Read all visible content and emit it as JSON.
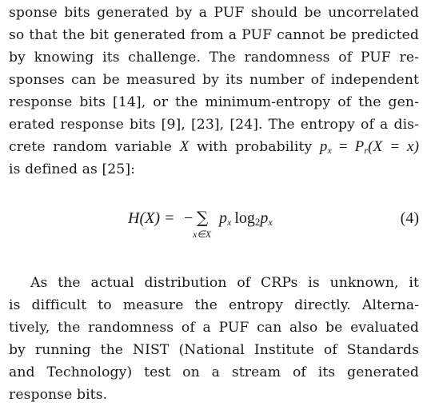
{
  "paragraph1": {
    "lines": [
      "sponse bits generated by a PUF should be uncorrelated",
      "so that the bit generated from a PUF cannot be predicted",
      "by knowing its challenge. The randomness of PUF re-",
      "sponses can be measured by its number of independent",
      "response bits [14], or the minimum-entropy of the gen-",
      "erated response bits [9], [23], [24]. The entropy of a dis-"
    ],
    "line7_prefix": "crete random variable ",
    "line7_var": "X",
    "line7_mid": " with probability ",
    "line7_p": "p",
    "line7_psub": "x",
    "line7_eq": " = ",
    "line7_P": "P",
    "line7_Psub": "r",
    "line7_expr": "(X = x)",
    "line8": "is defined as [25]:"
  },
  "equation": {
    "lhs": "H(X) =",
    "minus": "−",
    "sum_symbol": "∑",
    "sum_subscript": "x∈X",
    "term_p": "p",
    "term_psub": "x",
    "log": "log",
    "log_base": "2",
    "term_p2": "p",
    "term_p2sub": "x",
    "number": "(4)"
  },
  "paragraph2": {
    "lines": [
      "As the actual distribution of CRPs is unknown, it",
      "is difficult to measure the entropy directly. Alterna-",
      "tively, the randomness of a PUF can also be evaluated",
      "by running the NIST (National Institute of Standards",
      "and Technology) test on a stream of its generated",
      "response bits."
    ]
  }
}
